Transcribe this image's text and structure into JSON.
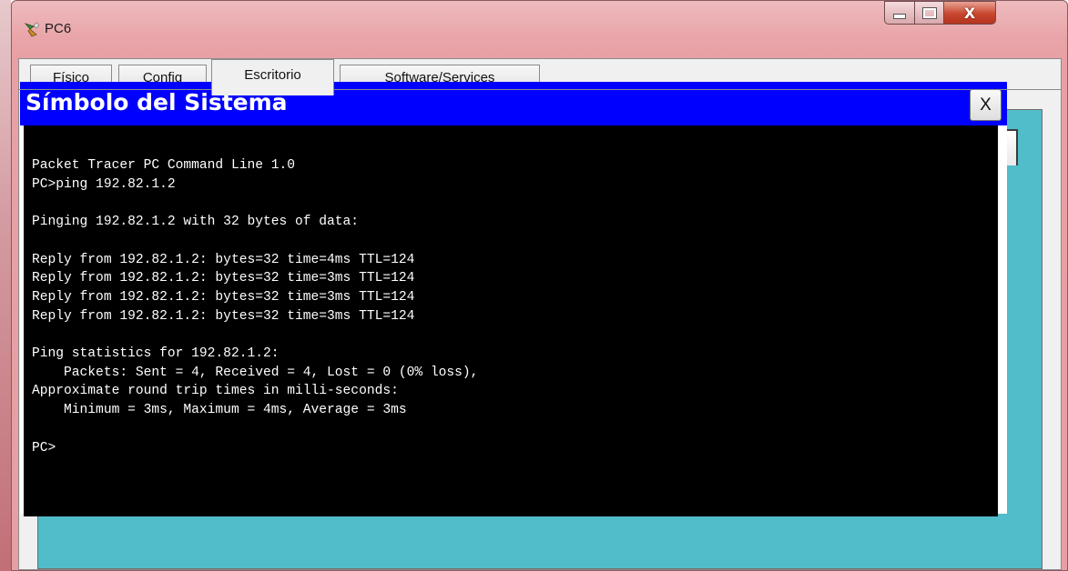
{
  "window": {
    "title": "PC6",
    "icon": "packet-tracer-pc-icon",
    "buttons": {
      "minimize": "minimize",
      "maximize": "maximize",
      "close": "X"
    }
  },
  "tabs": [
    {
      "label": "Físico",
      "active": false
    },
    {
      "label": "Config",
      "active": false
    },
    {
      "label": "Escritorio",
      "active": true
    },
    {
      "label": "Software/Services",
      "active": false
    }
  ],
  "command_prompt": {
    "title": "Símbolo del Sistema",
    "close_label": "X",
    "output": "Packet Tracer PC Command Line 1.0\nPC>ping 192.82.1.2\n\nPinging 192.82.1.2 with 32 bytes of data:\n\nReply from 192.82.1.2: bytes=32 time=4ms TTL=124\nReply from 192.82.1.2: bytes=32 time=3ms TTL=124\nReply from 192.82.1.2: bytes=32 time=3ms TTL=124\nReply from 192.82.1.2: bytes=32 time=3ms TTL=124\n\nPing statistics for 192.82.1.2:\n    Packets: Sent = 4, Received = 4, Lost = 0 (0% loss),\nApproximate round trip times in milli-seconds:\n    Minimum = 3ms, Maximum = 4ms, Average = 3ms\n\nPC>"
  },
  "colors": {
    "cmd_header": "#0000fe",
    "terminal_bg": "#000000",
    "terminal_text": "#ffffff",
    "desktop_bg": "#51bcca"
  }
}
